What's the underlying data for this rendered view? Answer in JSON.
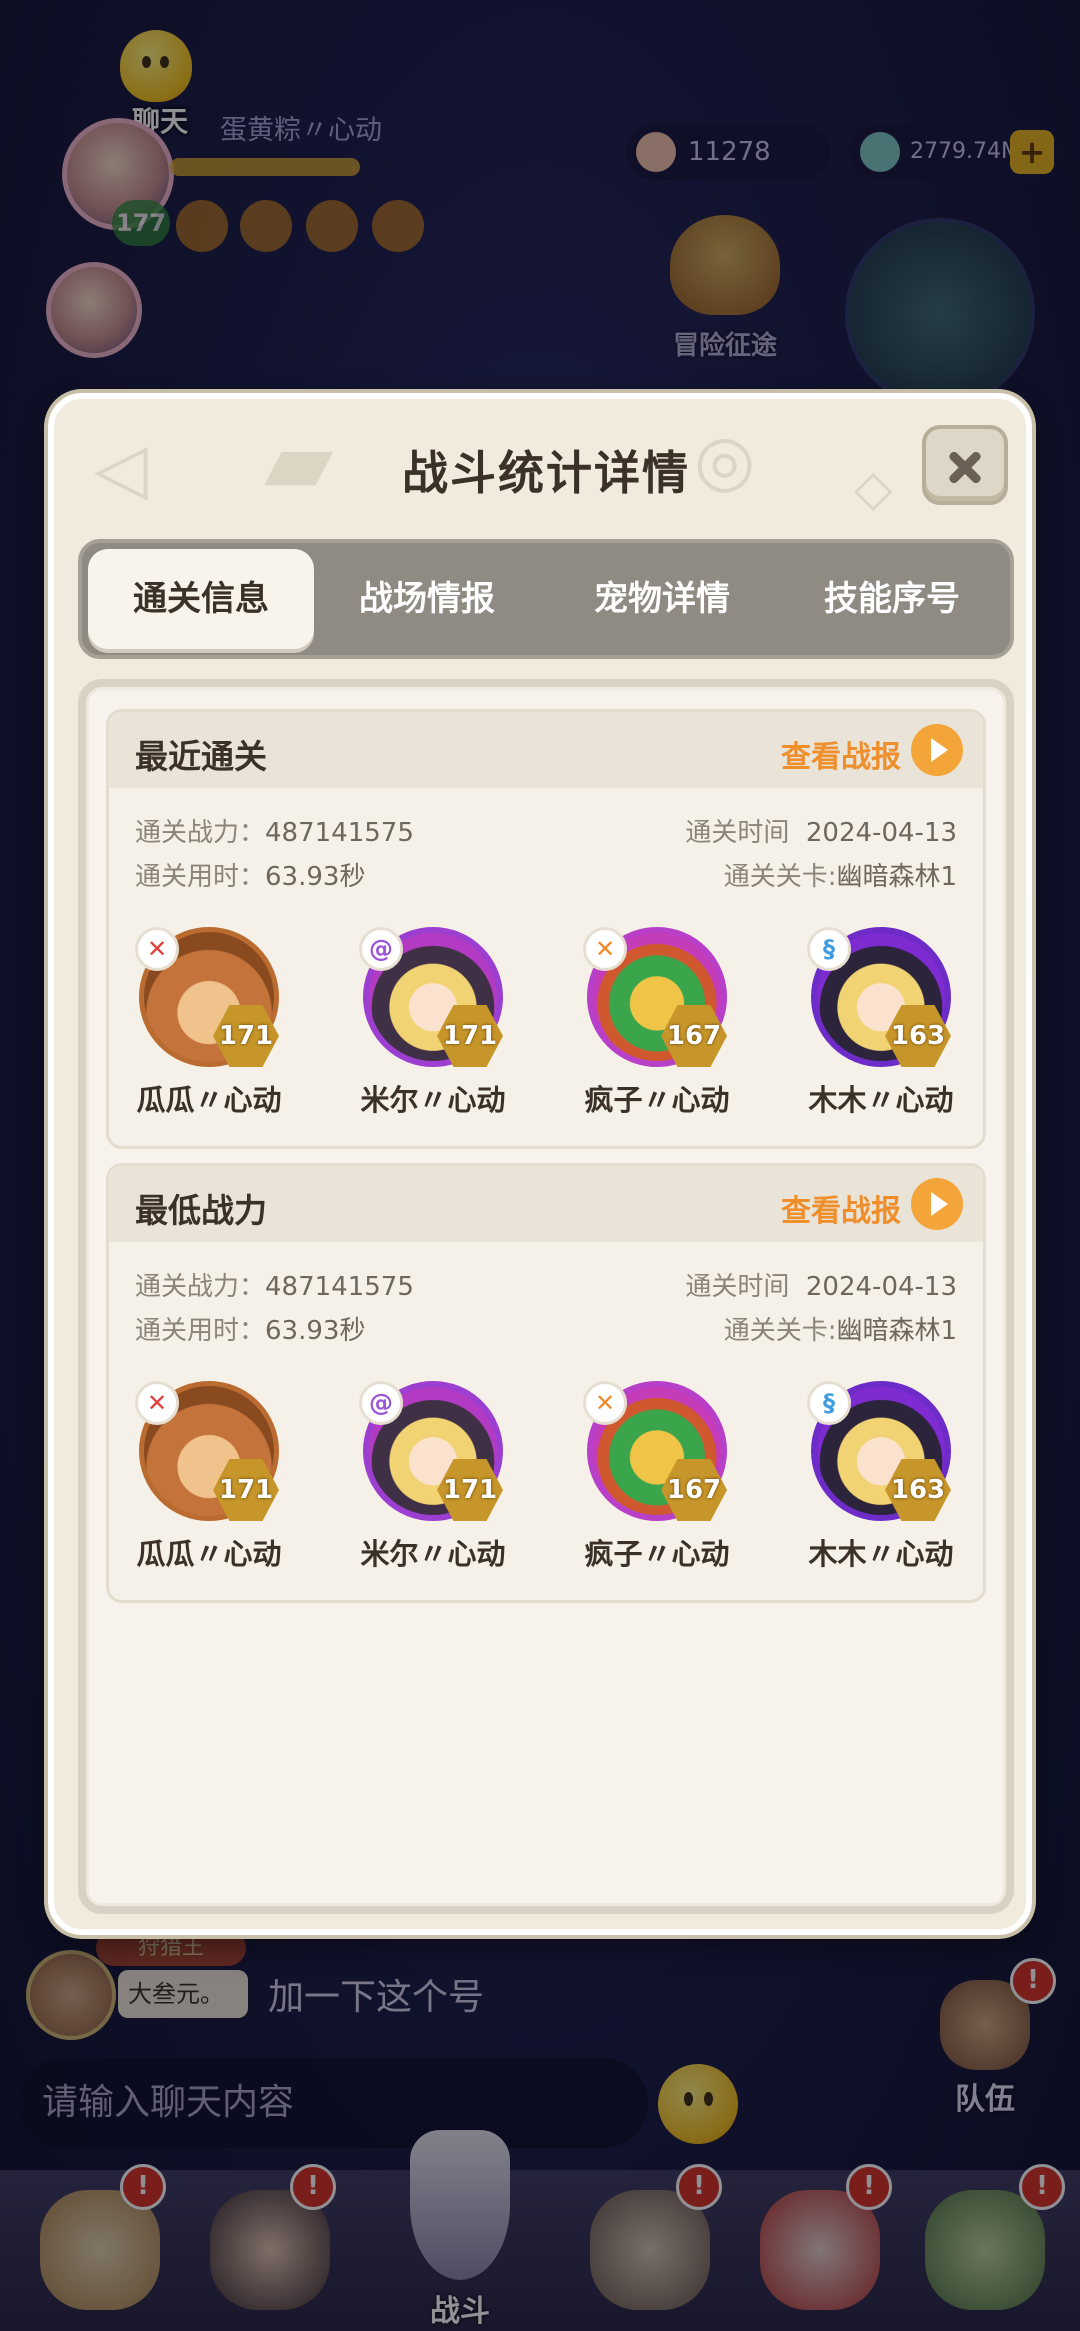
{
  "hud": {
    "chat_label": "聊天",
    "player_name": "蛋黄粽〃心动",
    "player_level": "177",
    "currency_1": "11278",
    "currency_2": "2779.74M",
    "adventure_label": "冒险征途"
  },
  "chat": {
    "title_badge": "狩猎王",
    "last_sender": "大叁元。",
    "last_message": "加一下这个号",
    "input_placeholder": "请输入聊天内容"
  },
  "team_label": "队伍",
  "nav": {
    "battle_label": "战斗"
  },
  "modal": {
    "title": "战斗统计详情",
    "tabs": [
      "通关信息",
      "战场情报",
      "宠物详情",
      "技能序号"
    ],
    "active_tab": 0,
    "sections": [
      {
        "title": "最近通关",
        "replay_label": "查看战报",
        "power_label": "通关战力：",
        "power_value": "487141575",
        "duration_label": "通关用时：",
        "duration_value": "63.93秒",
        "time_label": "通关时间",
        "time_value": "2024-04-13",
        "stage_label": "通关关卡:",
        "stage_value": "幽暗森林1",
        "pets": [
          {
            "name": "瓜瓜〃心动",
            "level": "171"
          },
          {
            "name": "米尔〃心动",
            "level": "171"
          },
          {
            "name": "疯子〃心动",
            "level": "167"
          },
          {
            "name": "木木〃心动",
            "level": "163"
          }
        ]
      },
      {
        "title": "最低战力",
        "replay_label": "查看战报",
        "power_label": "通关战力：",
        "power_value": "487141575",
        "duration_label": "通关用时：",
        "duration_value": "63.93秒",
        "time_label": "通关时间",
        "time_value": "2024-04-13",
        "stage_label": "通关关卡:",
        "stage_value": "幽暗森林1",
        "pets": [
          {
            "name": "瓜瓜〃心动",
            "level": "171"
          },
          {
            "name": "米尔〃心动",
            "level": "171"
          },
          {
            "name": "疯子〃心动",
            "level": "167"
          },
          {
            "name": "木木〃心动",
            "level": "163"
          }
        ]
      }
    ]
  }
}
